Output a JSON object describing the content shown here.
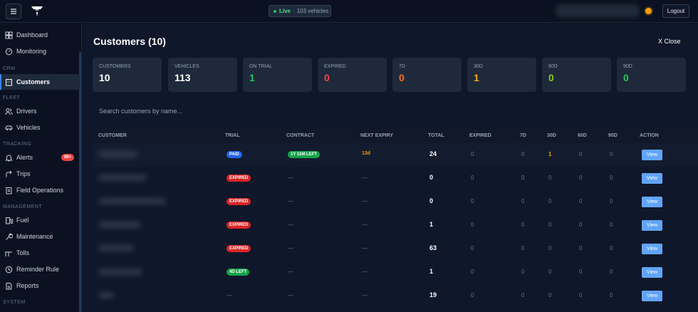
{
  "topbar": {
    "live_label": "Live",
    "live_sep": "·",
    "live_count": "103 vehicles",
    "logout_label": "Logout"
  },
  "sidebar": {
    "sections": {
      "crm": "CRM",
      "fleet": "FLEET",
      "tracking": "TRACKING",
      "management": "MANAGEMENT",
      "system": "SYSTEM"
    },
    "items": [
      {
        "label": "Dashboard",
        "icon": "grid-icon"
      },
      {
        "label": "Monitoring",
        "icon": "gauge-icon"
      },
      {
        "label": "Customers",
        "icon": "building-icon",
        "active": true
      },
      {
        "label": "Drivers",
        "icon": "users-icon"
      },
      {
        "label": "Vehicles",
        "icon": "car-icon"
      },
      {
        "label": "Alerts",
        "icon": "bell-icon",
        "badge": "99+"
      },
      {
        "label": "Trips",
        "icon": "route-icon"
      },
      {
        "label": "Field Operations",
        "icon": "clipboard-icon"
      },
      {
        "label": "Fuel",
        "icon": "fuel-icon"
      },
      {
        "label": "Maintenance",
        "icon": "wrench-icon"
      },
      {
        "label": "Tolls",
        "icon": "toll-icon"
      },
      {
        "label": "Reminder Rule",
        "icon": "clock-icon"
      },
      {
        "label": "Reports",
        "icon": "report-icon"
      }
    ]
  },
  "main": {
    "title": "Customers (10)",
    "close_label": "X Close",
    "search_placeholder": "Search customers by name..."
  },
  "stats": [
    {
      "label": "CUSTOMERS",
      "value": "10",
      "color": "#ffffff"
    },
    {
      "label": "VEHICLES",
      "value": "113",
      "color": "#ffffff"
    },
    {
      "label": "ON TRIAL",
      "value": "1",
      "color": "#22c55e"
    },
    {
      "label": "EXPIRED",
      "value": "0",
      "color": "#ef4444"
    },
    {
      "label": "7D",
      "value": "0",
      "color": "#f97316"
    },
    {
      "label": "30D",
      "value": "1",
      "color": "#eab308"
    },
    {
      "label": "60D",
      "value": "0",
      "color": "#84cc16"
    },
    {
      "label": "90D",
      "value": "0",
      "color": "#22c55e"
    }
  ],
  "table": {
    "headers": [
      "CUSTOMER",
      "TRIAL",
      "CONTRACT",
      "NEXT EXPIRY",
      "TOTAL",
      "EXPIRED",
      "7D",
      "30D",
      "60D",
      "90D",
      "ACTION"
    ],
    "rows": [
      {
        "trial": "PAID",
        "trial_color": "#2563eb",
        "contract": "1Y 11M LEFT",
        "expiry": "13d",
        "total": "24",
        "expired": "0",
        "d7": "0",
        "d30": "1",
        "d60": "0",
        "d90": "0",
        "action": "View"
      },
      {
        "trial": "EXPIRED",
        "trial_color": "#dc2626",
        "contract": "—",
        "expiry": "—",
        "total": "0",
        "expired": "0",
        "d7": "0",
        "d30": "0",
        "d60": "0",
        "d90": "0",
        "action": "View"
      },
      {
        "trial": "EXPIRED",
        "trial_color": "#dc2626",
        "contract": "—",
        "expiry": "—",
        "total": "0",
        "expired": "0",
        "d7": "0",
        "d30": "0",
        "d60": "0",
        "d90": "0",
        "action": "View"
      },
      {
        "trial": "EXPIRED",
        "trial_color": "#dc2626",
        "contract": "—",
        "expiry": "—",
        "total": "1",
        "expired": "0",
        "d7": "0",
        "d30": "0",
        "d60": "0",
        "d90": "0",
        "action": "View"
      },
      {
        "trial": "EXPIRED",
        "trial_color": "#dc2626",
        "contract": "—",
        "expiry": "—",
        "total": "63",
        "expired": "0",
        "d7": "0",
        "d30": "0",
        "d60": "0",
        "d90": "0",
        "action": "View"
      },
      {
        "trial": "4D LEFT",
        "trial_color": "#16a34a",
        "contract": "—",
        "expiry": "—",
        "total": "1",
        "expired": "0",
        "d7": "0",
        "d30": "0",
        "d60": "0",
        "d90": "0",
        "action": "View"
      },
      {
        "trial": "—",
        "trial_color": "",
        "contract": "—",
        "expiry": "—",
        "total": "19",
        "expired": "0",
        "d7": "0",
        "d30": "0",
        "d60": "0",
        "d90": "0",
        "action": "View"
      }
    ]
  },
  "colors": {
    "accent": "#3b82f6",
    "live": "#22c55e",
    "expiry_warn": "#f59e0b"
  }
}
